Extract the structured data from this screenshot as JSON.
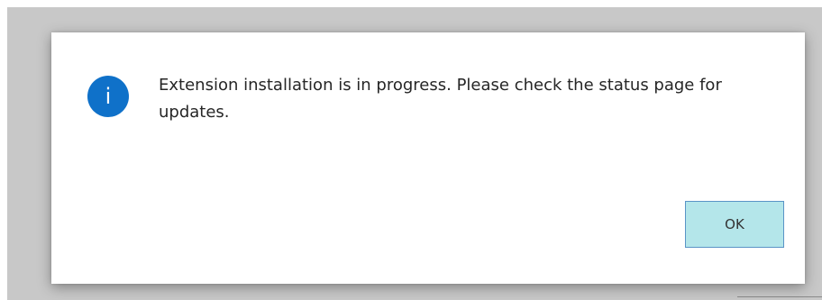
{
  "dialog": {
    "icon": "info-icon",
    "icon_glyph": "i",
    "message": "Extension installation is in progress. Please check the status page for updates.",
    "ok_label": "OK",
    "colors": {
      "icon_background": "#0f71c9",
      "ok_button_background": "#b4e6ea",
      "ok_button_border": "#5a94c6"
    }
  }
}
